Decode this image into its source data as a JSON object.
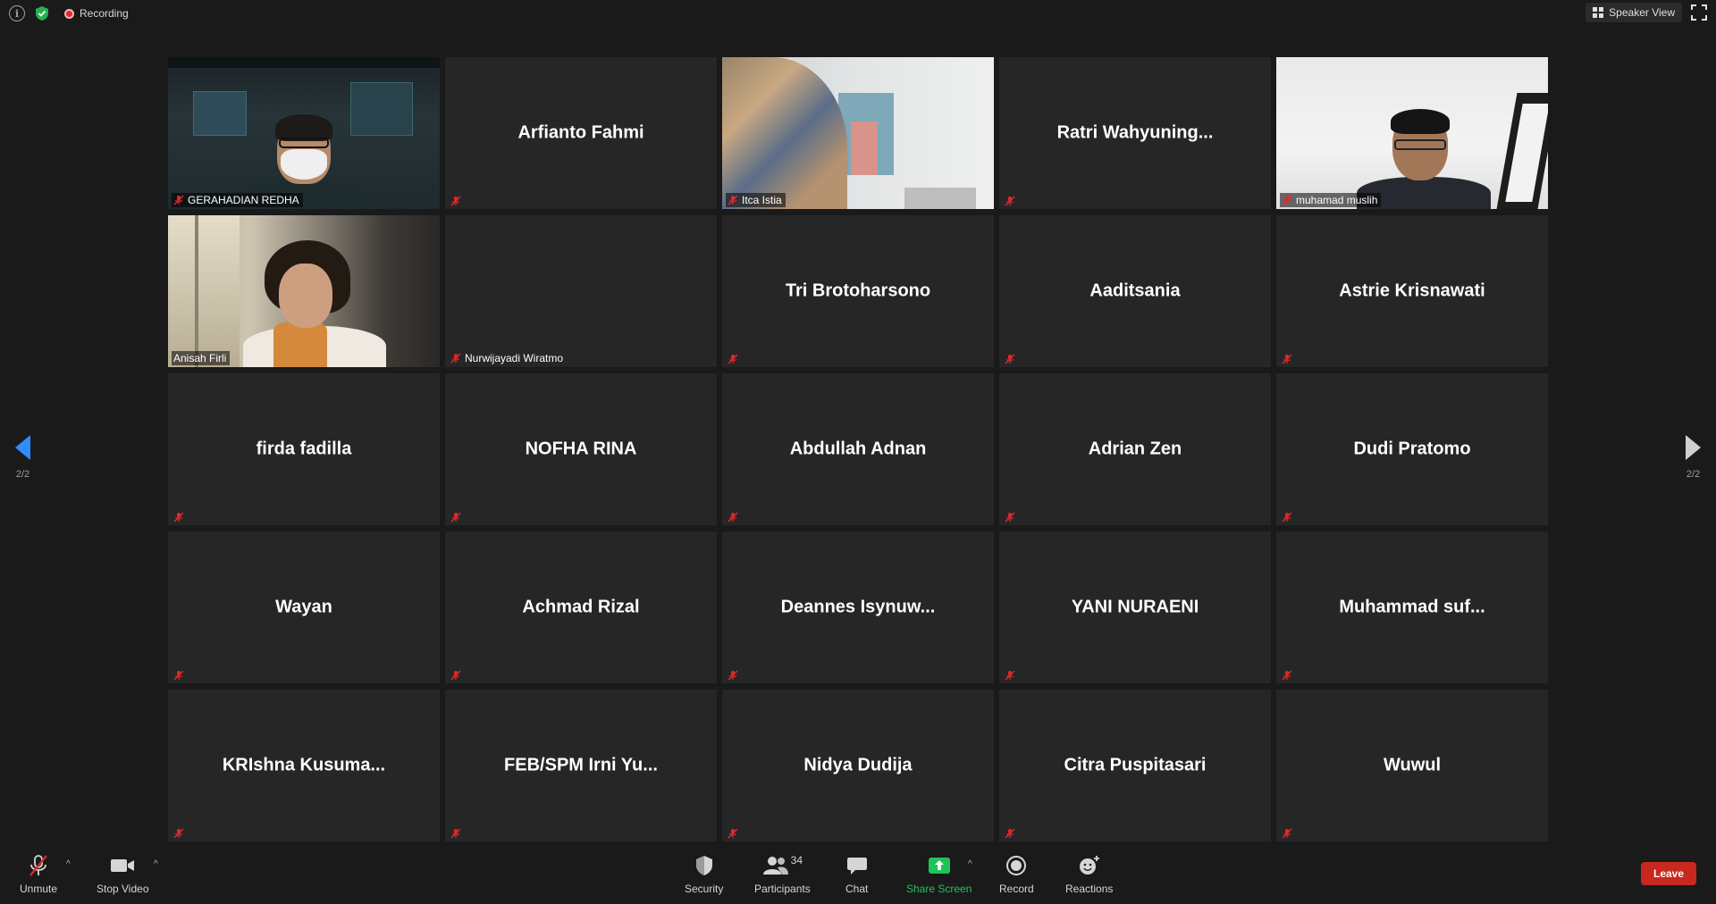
{
  "topbar": {
    "recording_label": "Recording",
    "view_label": "Speaker View"
  },
  "pagination": {
    "left_page": "2/2",
    "right_page": "2/2"
  },
  "tiles": [
    {
      "name": "GERAHADIAN REDHA",
      "video": true
    },
    {
      "name": "Arfianto Fahmi",
      "video": false
    },
    {
      "name": "Itca Istia",
      "video": true
    },
    {
      "name": "Ratri  Wahyuning...",
      "video": false
    },
    {
      "name": "muhamad muslih",
      "video": true
    },
    {
      "name": "Anisah Firli",
      "video": true
    },
    {
      "name": "Nurwijayadi Wiratmo",
      "video": false
    },
    {
      "name": "Tri Brotoharsono",
      "video": false
    },
    {
      "name": "Aaditsania",
      "video": false
    },
    {
      "name": "Astrie Krisnawati",
      "video": false
    },
    {
      "name": "firda fadilla",
      "video": false
    },
    {
      "name": "NOFHA RINA",
      "video": false
    },
    {
      "name": "Abdullah Adnan",
      "video": false
    },
    {
      "name": "Adrian Zen",
      "video": false
    },
    {
      "name": "Dudi Pratomo",
      "video": false
    },
    {
      "name": "Wayan",
      "video": false
    },
    {
      "name": "Achmad Rizal",
      "video": false
    },
    {
      "name": "Deannes  Isynuw...",
      "video": false
    },
    {
      "name": "YANI NURAENI",
      "video": false
    },
    {
      "name": "Muhammad  suf...",
      "video": false
    },
    {
      "name": "KRIshna  Kusuma...",
      "video": false
    },
    {
      "name": "FEB/SPM  Irni  Yu...",
      "video": false
    },
    {
      "name": "Nidya Dudija",
      "video": false
    },
    {
      "name": "Citra Puspitasari",
      "video": false
    },
    {
      "name": "Wuwul",
      "video": false
    }
  ],
  "toolbar": {
    "unmute_label": "Unmute",
    "stop_video_label": "Stop Video",
    "security_label": "Security",
    "participants_label": "Participants",
    "participants_count": "34",
    "chat_label": "Chat",
    "share_screen_label": "Share Screen",
    "record_label": "Record",
    "reactions_label": "Reactions",
    "leave_label": "Leave"
  },
  "colors": {
    "background": "#1a1a1a",
    "tile": "#262626",
    "accent_blue": "#2d8cff",
    "share_green": "#20c35a",
    "leave_red": "#c8281e",
    "muted_red": "#e02828"
  }
}
